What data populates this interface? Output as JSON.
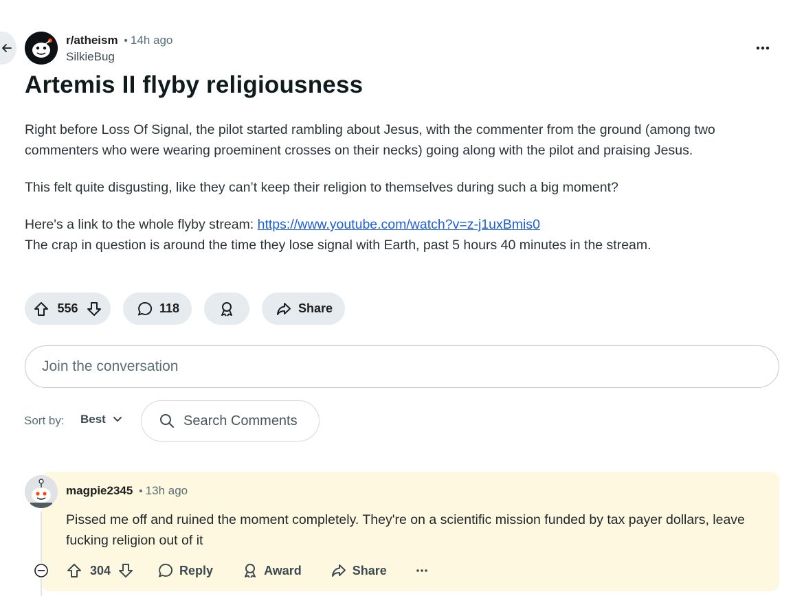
{
  "post": {
    "subreddit": "r/atheism",
    "time_ago": "14h ago",
    "author": "SilkieBug",
    "title": "Artemis II flyby religiousness",
    "paragraph1": "Right before Loss Of Signal, the pilot started rambling about Jesus, with the commenter from the ground (among two commenters who were wearing proeminent crosses on their necks) going along with the pilot and praising Jesus.",
    "paragraph2": "This felt quite disgusting, like they can’t keep their religion to themselves during such a big moment?",
    "link_intro": "Here's a link to the whole flyby stream: ",
    "link_url": "https://www.youtube.com/watch?v=z-j1uxBmis0",
    "paragraph4": "The crap in question is around the time they lose signal with Earth, past 5 hours 40 minutes in the stream.",
    "votes": "556",
    "comments": "118",
    "share_label": "Share"
  },
  "composer": {
    "placeholder": "Join the conversation"
  },
  "sort": {
    "label": "Sort by:",
    "value": "Best"
  },
  "search": {
    "label": "Search Comments"
  },
  "comment": {
    "author": "magpie2345",
    "time_ago": "13h ago",
    "text": "Pissed me off and ruined the moment completely. They're on a scientific mission funded by tax payer dollars, leave fucking religion out of it",
    "votes": "304",
    "reply_label": "Reply",
    "award_label": "Award",
    "share_label": "Share"
  },
  "icons": [
    "back-arrow-icon",
    "more-icon",
    "upvote-icon",
    "downvote-icon",
    "comment-icon",
    "award-icon",
    "share-icon",
    "chevron-down-icon",
    "search-icon",
    "collapse-icon"
  ],
  "colors": {
    "link": "#1a5fd6",
    "pill_bg": "#e5ebee",
    "comment_highlight": "#fff8e1"
  }
}
